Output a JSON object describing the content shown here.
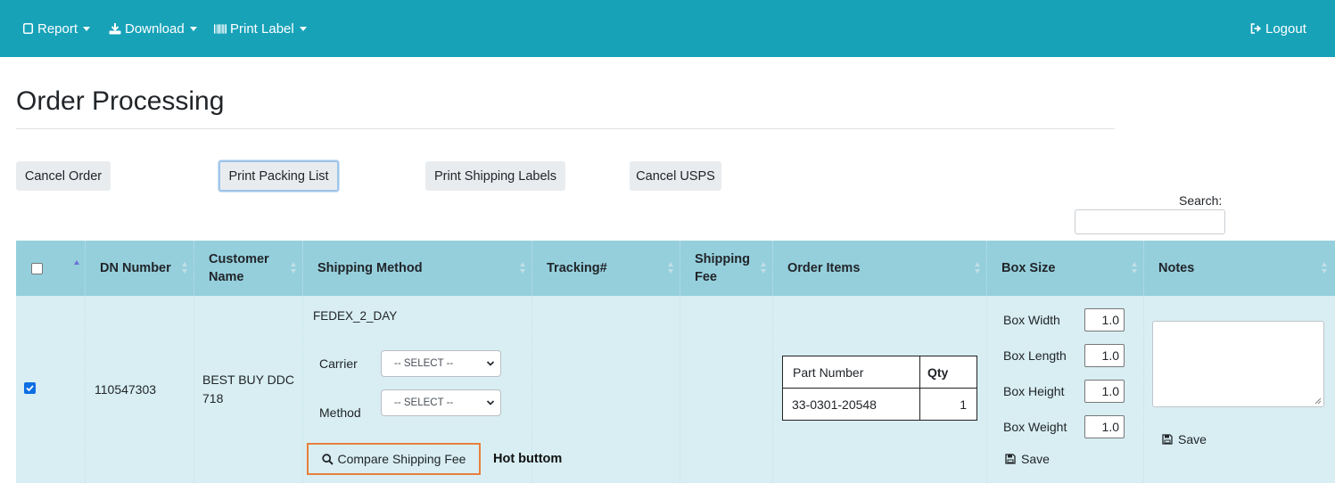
{
  "nav": {
    "report": "Report",
    "download": "Download",
    "print_label": "Print Label",
    "logout": "Logout"
  },
  "page": {
    "title": "Order Processing"
  },
  "actions": {
    "cancel_order": "Cancel Order",
    "print_packing_list": "Print Packing List",
    "print_shipping_labels": "Print Shipping Labels",
    "cancel_usps": "Cancel USPS"
  },
  "search": {
    "label": "Search:",
    "value": ""
  },
  "table": {
    "headers": {
      "dn_number": "DN Number",
      "customer_name_1": "Customer",
      "customer_name_2": "Name",
      "shipping_method": "Shipping Method",
      "tracking": "Tracking#",
      "shipping_fee_1": "Shipping",
      "shipping_fee_2": "Fee",
      "order_items": "Order Items",
      "box_size": "Box Size",
      "notes": "Notes"
    },
    "row": {
      "selected": true,
      "dn_number": "110547303",
      "customer_line1": "BEST BUY DDC",
      "customer_line2": "718",
      "shipping_method": "FEDEX_2_DAY",
      "carrier_label": "Carrier",
      "carrier_value": "-- SELECT --",
      "method_label": "Method",
      "method_value": "-- SELECT --",
      "compare_button": "Compare Shipping Fee",
      "annotation": "Hot buttom",
      "tracking": "",
      "items_table": {
        "headers": {
          "part_number": "Part Number",
          "qty": "Qty"
        },
        "rows": [
          {
            "part_number": "33-0301-20548",
            "qty": "1"
          }
        ]
      },
      "box": {
        "width_label": "Box Width",
        "width_value": "1.0",
        "length_label": "Box Length",
        "length_value": "1.0",
        "height_label": "Box Height",
        "height_value": "1.0",
        "weight_label": "Box Weight",
        "weight_value": "1.0",
        "save_label": "Save"
      },
      "notes_value": "",
      "notes_save_label": "Save"
    }
  }
}
